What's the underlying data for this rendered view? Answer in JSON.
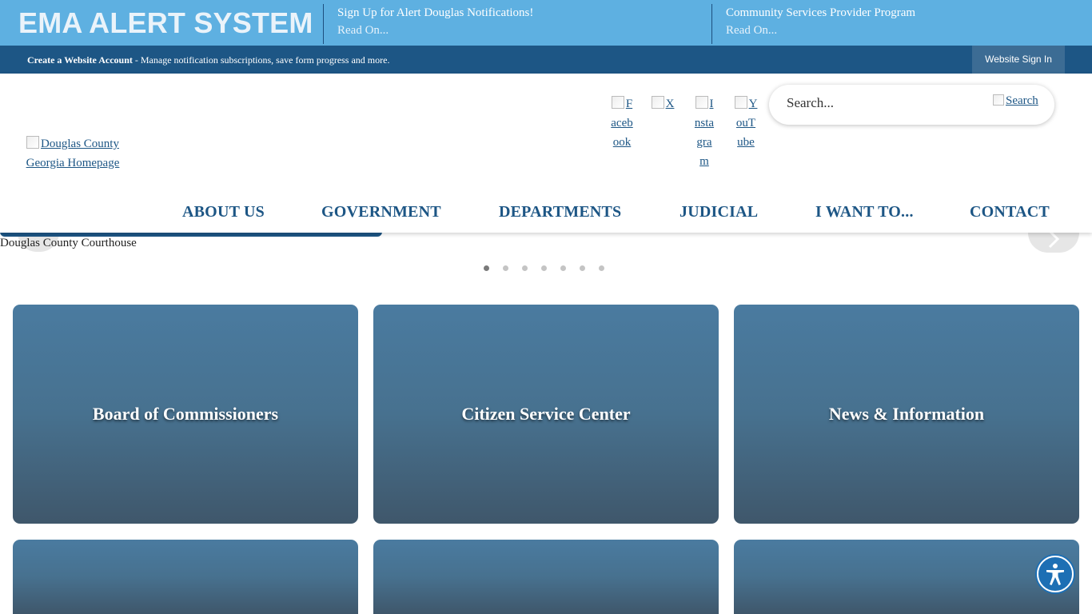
{
  "alert_bar": {
    "title": "EMA ALERT SYSTEM",
    "items": [
      {
        "title": "Sign Up for Alert Douglas Notifications!",
        "more": "Read On..."
      },
      {
        "title": "Community Services Provider Program",
        "more": "Read On..."
      }
    ]
  },
  "account_bar": {
    "link": "Create a Website Account",
    "text": " - Manage notification subscriptions, save form progress and more.",
    "signin": "Website Sign In"
  },
  "header": {
    "logo_alt": "Douglas County Georgia Homepage",
    "social": [
      "Facebook",
      "X",
      "Instagram",
      "YouTube"
    ],
    "search_placeholder": "Search...",
    "search_button": "Search"
  },
  "nav": {
    "items": [
      "ABOUT US",
      "GOVERNMENT",
      "DEPARTMENTS",
      "JUDICIAL",
      "I WANT TO...",
      "CONTACT"
    ]
  },
  "slideshow": {
    "image_alt": "Douglas County Courthouse",
    "dot_count": 7,
    "active_index": 0
  },
  "tiles": [
    {
      "label": "Board of Commissioners"
    },
    {
      "label": "Citizen Service Center"
    },
    {
      "label": "News & Information"
    },
    {
      "label": ""
    },
    {
      "label": ""
    },
    {
      "label": ""
    }
  ],
  "colors": {
    "alert_bg": "#5eb0e1",
    "account_bg": "#1d5685",
    "nav_text": "#1d5685",
    "tile_top": "#4a7ba0",
    "tile_bottom": "#3f576b"
  },
  "icons": {
    "accessibility": "accessibility-icon",
    "next": "chevron-right-icon",
    "prev": "chevron-left-icon"
  }
}
